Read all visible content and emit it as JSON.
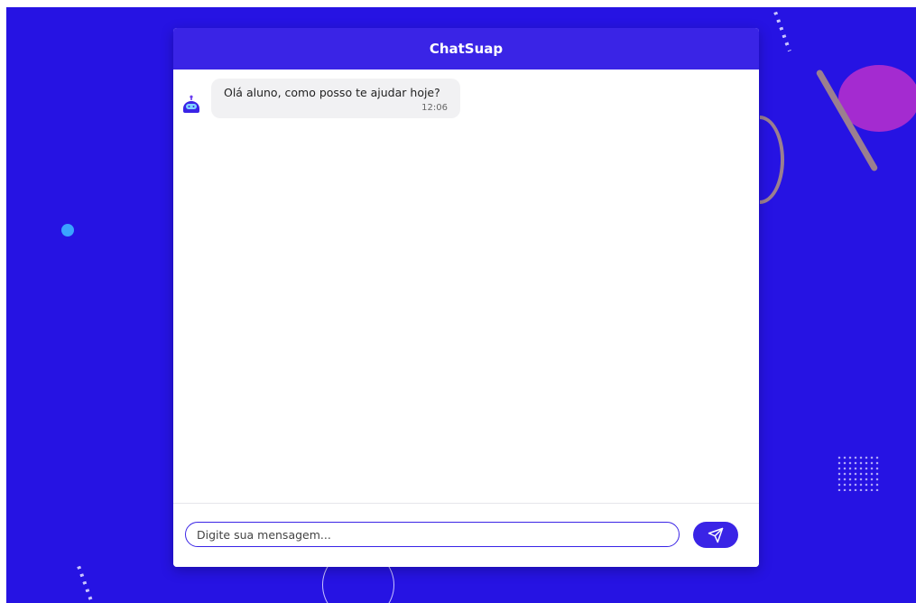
{
  "header": {
    "title": "ChatSuap"
  },
  "messages": [
    {
      "sender": "bot",
      "avatar_icon": "robot-icon",
      "text": "Olá aluno, como posso te ajudar hoje?",
      "time": "12:06"
    }
  ],
  "composer": {
    "placeholder": "Digite sua mensagem...",
    "send_icon": "paper-plane-icon"
  },
  "colors": {
    "background": "#2613e3",
    "accent": "#3a24e6",
    "bubble": "#f1f1f3",
    "decor_pink": "#a42bd0",
    "decor_blue": "#3aa3ff"
  }
}
